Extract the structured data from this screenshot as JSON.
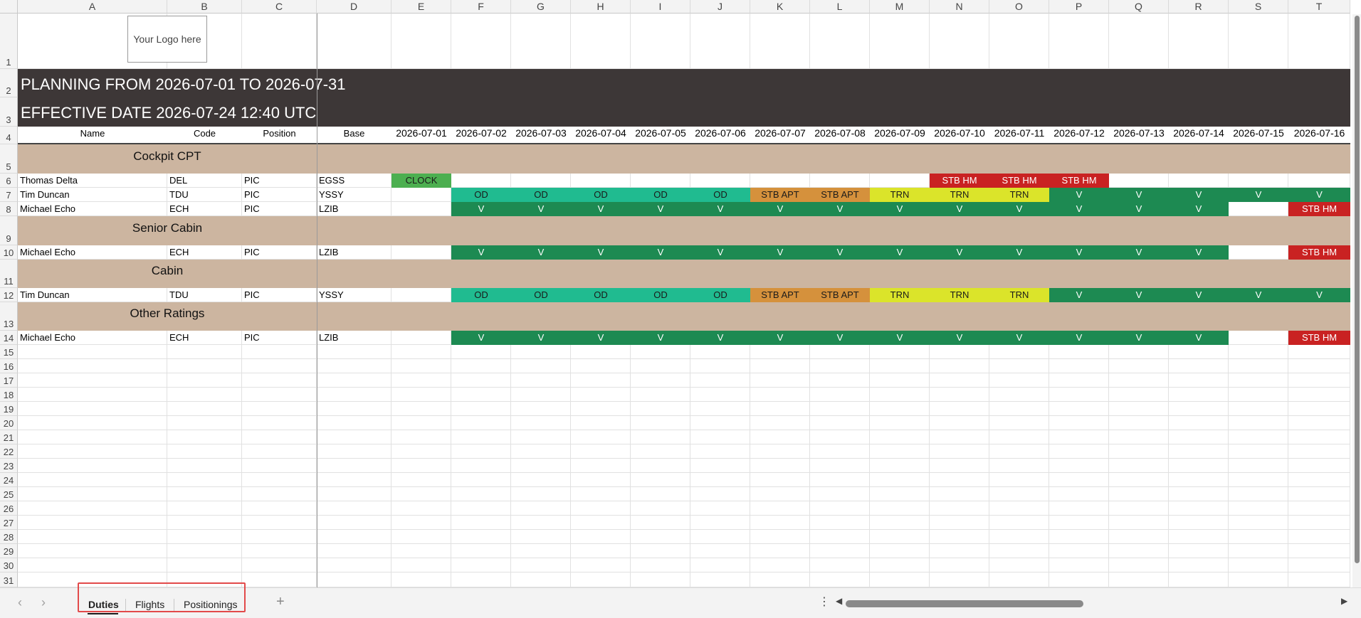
{
  "colors": {
    "title_band": "#3d3737",
    "group_band": "#ccb5a0",
    "OD": "#20bb90",
    "V": "#1d8a52",
    "STB APT": "#d5913c",
    "TRN": "#dbe42a",
    "STB HM": "#c92222",
    "CLOCK": "#4caf50"
  },
  "columns": [
    "A",
    "B",
    "C",
    "D",
    "E",
    "F",
    "G",
    "H",
    "I",
    "J",
    "K",
    "L",
    "M",
    "N",
    "O",
    "P",
    "Q",
    "R",
    "S",
    "T"
  ],
  "row_numbers": [
    "1",
    "2",
    "3",
    "4",
    "5",
    "6",
    "7",
    "8",
    "9",
    "10",
    "11",
    "12",
    "13",
    "14",
    "15",
    "16",
    "17",
    "18",
    "19",
    "20",
    "21",
    "22",
    "23",
    "24",
    "25",
    "26",
    "27",
    "28",
    "29",
    "30",
    "31"
  ],
  "logo": {
    "text": "Your Logo here"
  },
  "header": {
    "planning": "PLANNING FROM 2026-07-01 TO 2026-07-31",
    "effective": "EFFECTIVE DATE 2026-07-24 12:40 UTC"
  },
  "table_headers": [
    "Name",
    "Code",
    "Position",
    "Base"
  ],
  "dates": [
    "2026-07-01",
    "2026-07-02",
    "2026-07-03",
    "2026-07-04",
    "2026-07-05",
    "2026-07-06",
    "2026-07-07",
    "2026-07-08",
    "2026-07-09",
    "2026-07-10",
    "2026-07-11",
    "2026-07-12",
    "2026-07-13",
    "2026-07-14",
    "2026-07-15",
    "2026-07-16"
  ],
  "sections": [
    {
      "title": "Cockpit CPT",
      "row": 5,
      "crew": [
        {
          "row": 6,
          "name": "Thomas Delta",
          "code": "DEL",
          "position": "PIC",
          "base": "EGSS",
          "duties": [
            "CLOCK",
            "",
            "",
            "",
            "",
            "",
            "",
            "",
            "",
            "STB HM",
            "STB HM",
            "STB HM",
            "",
            "",
            "",
            ""
          ]
        },
        {
          "row": 7,
          "name": "Tim Duncan",
          "code": "TDU",
          "position": "PIC",
          "base": "YSSY",
          "duties": [
            "",
            "OD",
            "OD",
            "OD",
            "OD",
            "OD",
            "STB APT",
            "STB APT",
            "TRN",
            "TRN",
            "TRN",
            "V",
            "V",
            "V",
            "V",
            "V"
          ]
        },
        {
          "row": 8,
          "name": "Michael Echo",
          "code": "ECH",
          "position": "PIC",
          "base": "LZIB",
          "duties": [
            "",
            "V",
            "V",
            "V",
            "V",
            "V",
            "V",
            "V",
            "V",
            "V",
            "V",
            "V",
            "V",
            "V",
            "",
            "STB HM"
          ]
        }
      ]
    },
    {
      "title": "Senior Cabin",
      "row": 9,
      "crew": [
        {
          "row": 10,
          "name": "Michael Echo",
          "code": "ECH",
          "position": "PIC",
          "base": "LZIB",
          "duties": [
            "",
            "V",
            "V",
            "V",
            "V",
            "V",
            "V",
            "V",
            "V",
            "V",
            "V",
            "V",
            "V",
            "V",
            "",
            "STB HM"
          ]
        }
      ]
    },
    {
      "title": "Cabin",
      "row": 11,
      "crew": [
        {
          "row": 12,
          "name": "Tim Duncan",
          "code": "TDU",
          "position": "PIC",
          "base": "YSSY",
          "duties": [
            "",
            "OD",
            "OD",
            "OD",
            "OD",
            "OD",
            "STB APT",
            "STB APT",
            "TRN",
            "TRN",
            "TRN",
            "V",
            "V",
            "V",
            "V",
            "V"
          ]
        }
      ]
    },
    {
      "title": "Other Ratings",
      "row": 13,
      "crew": [
        {
          "row": 14,
          "name": "Michael Echo",
          "code": "ECH",
          "position": "PIC",
          "base": "LZIB",
          "duties": [
            "",
            "V",
            "V",
            "V",
            "V",
            "V",
            "V",
            "V",
            "V",
            "V",
            "V",
            "V",
            "V",
            "V",
            "",
            "STB HM"
          ]
        }
      ]
    }
  ],
  "sheet_tabs": [
    {
      "label": "Duties",
      "active": true
    },
    {
      "label": "Flights",
      "active": false
    },
    {
      "label": "Positionings",
      "active": false
    }
  ],
  "icons": {
    "prev_sheet": "chevron-left-icon",
    "next_sheet": "chevron-right-icon",
    "add_sheet": "plus-icon",
    "more": "vertical-ellipsis-icon",
    "scroll_left": "triangle-left-icon",
    "scroll_right": "triangle-right-icon"
  }
}
